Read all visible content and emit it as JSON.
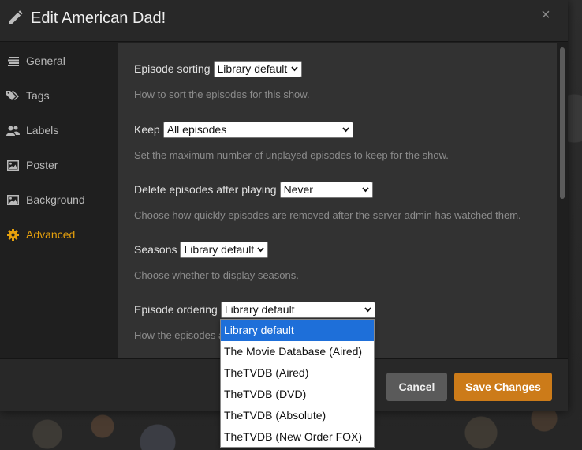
{
  "modal": {
    "title": "Edit American Dad!",
    "close_symbol": "×"
  },
  "sidebar": {
    "items": [
      {
        "label": "General",
        "icon": "lines-icon",
        "active": false
      },
      {
        "label": "Tags",
        "icon": "tag-icon",
        "active": false
      },
      {
        "label": "Labels",
        "icon": "users-icon",
        "active": false
      },
      {
        "label": "Poster",
        "icon": "image-icon",
        "active": false
      },
      {
        "label": "Background",
        "icon": "image-icon",
        "active": false
      },
      {
        "label": "Advanced",
        "icon": "gear-icon",
        "active": true
      }
    ]
  },
  "fields": {
    "episode_sorting": {
      "label": "Episode sorting",
      "value": "Library default",
      "hint": "How to sort the episodes for this show."
    },
    "keep": {
      "label": "Keep",
      "value": "All episodes",
      "hint": "Set the maximum number of unplayed episodes to keep for the show."
    },
    "delete_after": {
      "label": "Delete episodes after playing",
      "value": "Never",
      "hint": "Choose how quickly episodes are removed after the server admin has watched them."
    },
    "seasons": {
      "label": "Seasons",
      "value": "Library default",
      "hint": "Choose whether to display seasons."
    },
    "episode_ordering": {
      "label": "Episode ordering",
      "value": "Library default",
      "hint": "How the episodes a"
    }
  },
  "dropdown": {
    "options": [
      "Library default",
      "The Movie Database (Aired)",
      "TheTVDB (Aired)",
      "TheTVDB (DVD)",
      "TheTVDB (Absolute)",
      "TheTVDB (New Order FOX)"
    ],
    "selected_index": 0
  },
  "footer": {
    "cancel_label": "Cancel",
    "save_label": "Save Changes"
  },
  "colors": {
    "accent": "#e5a00d",
    "save_button": "#cc7b19",
    "dropdown_highlight": "#1e6fd9"
  }
}
